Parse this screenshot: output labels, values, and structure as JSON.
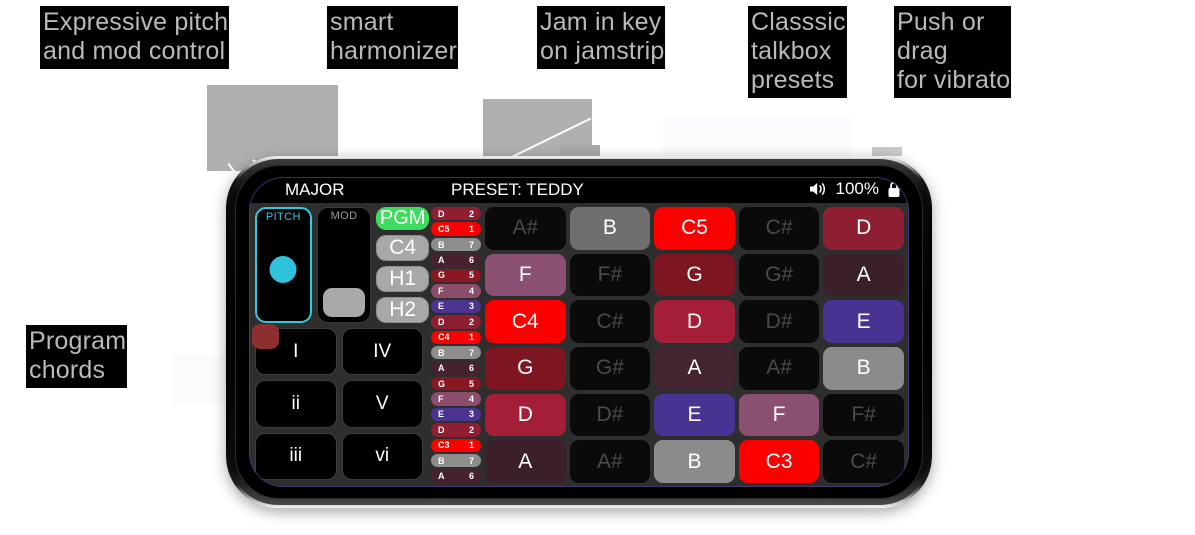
{
  "annotations": [
    {
      "id": "pitch-mod",
      "text": "Expressive pitch\nand mod control"
    },
    {
      "id": "harmonizer",
      "text": "smart\nharmonizer"
    },
    {
      "id": "jamstrip",
      "text": "Jam in key\non jamstrip"
    },
    {
      "id": "talkbox",
      "text": "Classsic\ntalkbox\npresets"
    },
    {
      "id": "vibrato",
      "text": "Push or\ndrag\nfor vibrato"
    },
    {
      "id": "program-chords",
      "text": "Program\nchords"
    }
  ],
  "statusbar": {
    "scale": "MAJOR",
    "preset": "PRESET: TEDDY",
    "volume": "100%",
    "speaker_icon": "speaker-icon",
    "lock_icon": "lock-icon"
  },
  "controls": {
    "pitch_label": "PITCH",
    "mod_label": "MOD",
    "buttons": [
      {
        "label": "PGM",
        "style": "green"
      },
      {
        "label": "C4",
        "style": "grey"
      },
      {
        "label": "H1",
        "style": "grey"
      },
      {
        "label": "H2",
        "style": "grey"
      }
    ],
    "chords": [
      "I",
      "IV",
      "ii",
      "V",
      "iii",
      "vi"
    ]
  },
  "jamstrip": [
    {
      "note": "D",
      "degree": "2",
      "color": "#8e1f33"
    },
    {
      "note": "C5",
      "degree": "1",
      "color": "#fc0000"
    },
    {
      "note": "B",
      "degree": "7",
      "color": "#8d8d8d"
    },
    {
      "note": "A",
      "degree": "6",
      "color": "#46222e"
    },
    {
      "note": "G",
      "degree": "5",
      "color": "#8a1822"
    },
    {
      "note": "F",
      "degree": "4",
      "color": "#8b4d6a"
    },
    {
      "note": "E",
      "degree": "3",
      "color": "#4a3490"
    },
    {
      "note": "D",
      "degree": "2",
      "color": "#8e1f33"
    },
    {
      "note": "C4",
      "degree": "1",
      "color": "#fc0000"
    },
    {
      "note": "B",
      "degree": "7",
      "color": "#8d8d8d"
    },
    {
      "note": "A",
      "degree": "6",
      "color": "#46222e"
    },
    {
      "note": "G",
      "degree": "5",
      "color": "#8a1822"
    },
    {
      "note": "F",
      "degree": "4",
      "color": "#8b4d6a"
    },
    {
      "note": "E",
      "degree": "3",
      "color": "#4a3490"
    },
    {
      "note": "D",
      "degree": "2",
      "color": "#8e1f33"
    },
    {
      "note": "C3",
      "degree": "1",
      "color": "#fc0000"
    },
    {
      "note": "B",
      "degree": "7",
      "color": "#8d8d8d"
    },
    {
      "note": "A",
      "degree": "6",
      "color": "#46222e"
    }
  ],
  "notegrid": {
    "rows": 6,
    "cols": 5,
    "cells": [
      {
        "label": "A#",
        "color": "#0a0a0a",
        "dim": true
      },
      {
        "label": "B",
        "color": "#6e6e6e",
        "dim": false
      },
      {
        "label": "C5",
        "color": "#fc0000",
        "dim": false
      },
      {
        "label": "C#",
        "color": "#0a0a0a",
        "dim": true
      },
      {
        "label": "D",
        "color": "#8e1f33",
        "dim": false
      },
      {
        "label": "F",
        "color": "#8b5071",
        "dim": false
      },
      {
        "label": "F#",
        "color": "#0a0a0a",
        "dim": true
      },
      {
        "label": "G",
        "color": "#7d1620",
        "dim": false
      },
      {
        "label": "G#",
        "color": "#0a0a0a",
        "dim": true
      },
      {
        "label": "A",
        "color": "#3b2029",
        "dim": false
      },
      {
        "label": "C4",
        "color": "#fc0000",
        "dim": false
      },
      {
        "label": "C#",
        "color": "#0a0a0a",
        "dim": true
      },
      {
        "label": "D",
        "color": "#a41e38",
        "dim": false
      },
      {
        "label": "D#",
        "color": "#0a0a0a",
        "dim": true
      },
      {
        "label": "E",
        "color": "#483392",
        "dim": false
      },
      {
        "label": "G",
        "color": "#7d1620",
        "dim": false
      },
      {
        "label": "G#",
        "color": "#0a0a0a",
        "dim": true
      },
      {
        "label": "A",
        "color": "#442531",
        "dim": false
      },
      {
        "label": "A#",
        "color": "#0a0a0a",
        "dim": true
      },
      {
        "label": "B",
        "color": "#8b8b8b",
        "dim": false
      },
      {
        "label": "D",
        "color": "#a41e38",
        "dim": false
      },
      {
        "label": "D#",
        "color": "#0a0a0a",
        "dim": true
      },
      {
        "label": "E",
        "color": "#483392",
        "dim": false
      },
      {
        "label": "F",
        "color": "#8b5071",
        "dim": false
      },
      {
        "label": "F#",
        "color": "#0a0a0a",
        "dim": true
      },
      {
        "label": "A",
        "color": "#3b2029",
        "dim": false
      },
      {
        "label": "A#",
        "color": "#0a0a0a",
        "dim": true
      },
      {
        "label": "B",
        "color": "#8b8b8b",
        "dim": false
      },
      {
        "label": "C3",
        "color": "#fc0000",
        "dim": false
      },
      {
        "label": "C#",
        "color": "#0a0a0a",
        "dim": true
      }
    ]
  },
  "colors": {
    "accent_cyan": "#35c6e0",
    "accent_green": "#3ddc5f",
    "accent_red": "#fc0000",
    "app_bg": "#2e2e2e"
  }
}
